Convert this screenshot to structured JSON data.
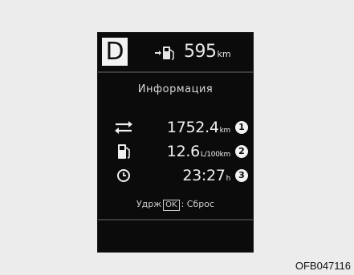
{
  "display": {
    "gear": "D",
    "range": {
      "icon": "fuel-pump-arrow-icon",
      "value": "595",
      "unit": "km"
    },
    "title": "Информация",
    "rows": [
      {
        "icon": "car-arrows-icon",
        "value": "1752.4",
        "unit": "km",
        "badge": "1"
      },
      {
        "icon": "fuel-pump-icon",
        "value": "12.6",
        "unit": "L/100km",
        "badge": "2"
      },
      {
        "icon": "clock-icon",
        "value": "23:27",
        "unit": "h",
        "badge": "3"
      }
    ],
    "hint": {
      "prefix": "Удрж",
      "key": "OK",
      "suffix": ": Сброс"
    }
  },
  "caption": "OFB047116",
  "colors": {
    "screen_bg": "#0b0b0b",
    "text": "#f0f0f0",
    "page_bg": "#ececec"
  }
}
